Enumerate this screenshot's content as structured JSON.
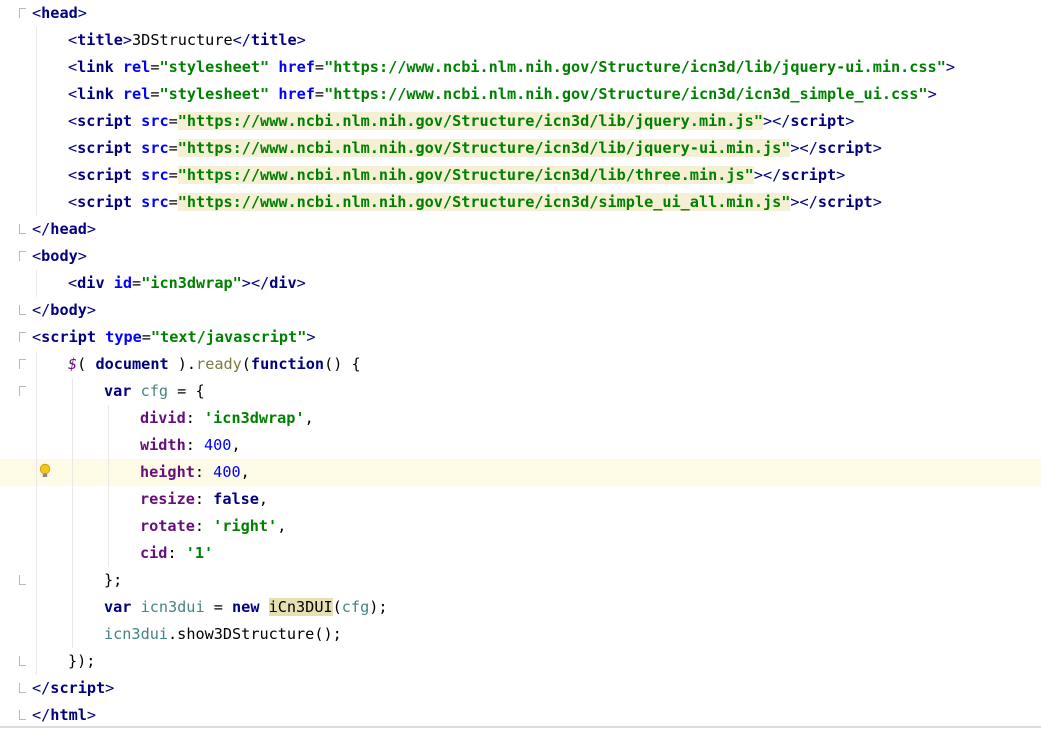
{
  "editor": {
    "lines": [
      {
        "indent": 0,
        "fold": "start",
        "parts": [
          [
            "bracket",
            "<"
          ],
          [
            "tag",
            "head"
          ],
          [
            "bracket",
            ">"
          ]
        ]
      },
      {
        "indent": 1,
        "parts": [
          [
            "bracket",
            "<"
          ],
          [
            "tag",
            "title"
          ],
          [
            "bracket",
            ">"
          ],
          [
            "plain",
            "3DStructure"
          ],
          [
            "bracket",
            "</"
          ],
          [
            "tag",
            "title"
          ],
          [
            "bracket",
            ">"
          ]
        ]
      },
      {
        "indent": 1,
        "parts": [
          [
            "bracket",
            "<"
          ],
          [
            "tag",
            "link "
          ],
          [
            "attr",
            "rel"
          ],
          [
            "plain",
            "="
          ],
          [
            "val",
            "\"stylesheet\" "
          ],
          [
            "attr",
            "href"
          ],
          [
            "plain",
            "="
          ],
          [
            "val",
            "\"https://www.ncbi.nlm.nih.gov/Structure/icn3d/lib/jquery-ui.min.css\""
          ],
          [
            "bracket",
            ">"
          ]
        ]
      },
      {
        "indent": 1,
        "parts": [
          [
            "bracket",
            "<"
          ],
          [
            "tag",
            "link "
          ],
          [
            "attr",
            "rel"
          ],
          [
            "plain",
            "="
          ],
          [
            "val",
            "\"stylesheet\" "
          ],
          [
            "attr",
            "href"
          ],
          [
            "plain",
            "="
          ],
          [
            "val",
            "\"https://www.ncbi.nlm.nih.gov/Structure/icn3d/icn3d_simple_ui.css\""
          ],
          [
            "bracket",
            ">"
          ]
        ]
      },
      {
        "indent": 1,
        "parts": [
          [
            "bracket",
            "<"
          ],
          [
            "tag",
            "script "
          ],
          [
            "attr",
            "src"
          ],
          [
            "plain",
            "="
          ],
          [
            "valhl",
            "\"https://www.ncbi.nlm.nih.gov/Structure/icn3d/lib/jquery.min.js\""
          ],
          [
            "bracket",
            ">"
          ],
          [
            "bracket",
            "</"
          ],
          [
            "tag",
            "script"
          ],
          [
            "bracket",
            ">"
          ]
        ]
      },
      {
        "indent": 1,
        "parts": [
          [
            "bracket",
            "<"
          ],
          [
            "tag",
            "script "
          ],
          [
            "attr",
            "src"
          ],
          [
            "plain",
            "="
          ],
          [
            "valhl",
            "\"https://www.ncbi.nlm.nih.gov/Structure/icn3d/lib/jquery-ui.min.js\""
          ],
          [
            "bracket",
            ">"
          ],
          [
            "bracket",
            "</"
          ],
          [
            "tag",
            "script"
          ],
          [
            "bracket",
            ">"
          ]
        ]
      },
      {
        "indent": 1,
        "parts": [
          [
            "bracket",
            "<"
          ],
          [
            "tag",
            "script "
          ],
          [
            "attr",
            "src"
          ],
          [
            "plain",
            "="
          ],
          [
            "valhl",
            "\"https://www.ncbi.nlm.nih.gov/Structure/icn3d/lib/three.min.js\""
          ],
          [
            "bracket",
            ">"
          ],
          [
            "bracket",
            "</"
          ],
          [
            "tag",
            "script"
          ],
          [
            "bracket",
            ">"
          ]
        ]
      },
      {
        "indent": 1,
        "parts": [
          [
            "bracket",
            "<"
          ],
          [
            "tag",
            "script "
          ],
          [
            "attr",
            "src"
          ],
          [
            "plain",
            "="
          ],
          [
            "valhl",
            "\"https://www.ncbi.nlm.nih.gov/Structure/icn3d/simple_ui_all.min.js\""
          ],
          [
            "bracket",
            ">"
          ],
          [
            "bracket",
            "</"
          ],
          [
            "tag",
            "script"
          ],
          [
            "bracket",
            ">"
          ]
        ]
      },
      {
        "indent": 0,
        "fold": "end",
        "parts": [
          [
            "bracket",
            "</"
          ],
          [
            "tag",
            "head"
          ],
          [
            "bracket",
            ">"
          ]
        ]
      },
      {
        "indent": 0,
        "fold": "start",
        "parts": [
          [
            "bracket",
            "<"
          ],
          [
            "tag",
            "body"
          ],
          [
            "bracket",
            ">"
          ]
        ]
      },
      {
        "indent": 1,
        "parts": [
          [
            "bracket",
            "<"
          ],
          [
            "tag",
            "div "
          ],
          [
            "attr",
            "id"
          ],
          [
            "plain",
            "="
          ],
          [
            "val",
            "\"icn3dwrap\""
          ],
          [
            "bracket",
            ">"
          ],
          [
            "bracket",
            "</"
          ],
          [
            "tag",
            "div"
          ],
          [
            "bracket",
            ">"
          ]
        ]
      },
      {
        "indent": 0,
        "fold": "end",
        "parts": [
          [
            "bracket",
            "</"
          ],
          [
            "tag",
            "body"
          ],
          [
            "bracket",
            ">"
          ]
        ]
      },
      {
        "indent": 0,
        "fold": "start",
        "parts": [
          [
            "bracket",
            "<"
          ],
          [
            "tag",
            "script "
          ],
          [
            "attr",
            "type"
          ],
          [
            "plain",
            "="
          ],
          [
            "val",
            "\"text/javascript\""
          ],
          [
            "bracket",
            ">"
          ]
        ]
      },
      {
        "indent": 1,
        "fold": "start",
        "parts": [
          [
            "dollar",
            "$"
          ],
          [
            "plain",
            "( "
          ],
          [
            "kw",
            "document "
          ],
          [
            "plain",
            ")."
          ],
          [
            "method",
            "ready"
          ],
          [
            "plain",
            "("
          ],
          [
            "kw",
            "function"
          ],
          [
            "plain",
            "() {"
          ]
        ]
      },
      {
        "indent": 2,
        "fold": "start",
        "parts": [
          [
            "kw",
            "var "
          ],
          [
            "ident",
            "cfg "
          ],
          [
            "plain",
            "= {"
          ]
        ]
      },
      {
        "indent": 3,
        "parts": [
          [
            "prop",
            "divid"
          ],
          [
            "plain",
            ": "
          ],
          [
            "val",
            "'icn3dwrap'"
          ],
          [
            "plain",
            ","
          ]
        ]
      },
      {
        "indent": 3,
        "parts": [
          [
            "prop",
            "width"
          ],
          [
            "plain",
            ": "
          ],
          [
            "num",
            "400"
          ],
          [
            "plain",
            ","
          ]
        ]
      },
      {
        "indent": 3,
        "current": true,
        "bulb": true,
        "parts": [
          [
            "prop",
            "height"
          ],
          [
            "plain",
            ": "
          ],
          [
            "num",
            "400"
          ],
          [
            "plain",
            ","
          ]
        ]
      },
      {
        "indent": 3,
        "parts": [
          [
            "prop",
            "resize"
          ],
          [
            "plain",
            ": "
          ],
          [
            "kw",
            "false"
          ],
          [
            "plain",
            ","
          ]
        ]
      },
      {
        "indent": 3,
        "parts": [
          [
            "prop",
            "rotate"
          ],
          [
            "plain",
            ": "
          ],
          [
            "val",
            "'right'"
          ],
          [
            "plain",
            ","
          ]
        ]
      },
      {
        "indent": 3,
        "parts": [
          [
            "prop",
            "cid"
          ],
          [
            "plain",
            ": "
          ],
          [
            "val",
            "'1'"
          ]
        ]
      },
      {
        "indent": 2,
        "fold": "end",
        "parts": [
          [
            "plain",
            "};"
          ]
        ]
      },
      {
        "indent": 2,
        "parts": [
          [
            "kw",
            "var "
          ],
          [
            "ident",
            "icn3dui "
          ],
          [
            "plain",
            "= "
          ],
          [
            "kw",
            "new "
          ],
          [
            "cls",
            "iCn3DUI"
          ],
          [
            "plain",
            "("
          ],
          [
            "ident",
            "cfg"
          ],
          [
            "plain",
            ");"
          ]
        ]
      },
      {
        "indent": 2,
        "parts": [
          [
            "ident",
            "icn3dui"
          ],
          [
            "plain",
            "."
          ],
          [
            "call",
            "show3DStructure"
          ],
          [
            "plain",
            "();"
          ]
        ]
      },
      {
        "indent": 1,
        "fold": "end",
        "parts": [
          [
            "plain",
            "});"
          ]
        ]
      },
      {
        "indent": 0,
        "fold": "end",
        "parts": [
          [
            "bracket",
            "</"
          ],
          [
            "tag",
            "script"
          ],
          [
            "bracket",
            ">"
          ]
        ]
      },
      {
        "indent": 0,
        "fold": "end",
        "parts": [
          [
            "bracket",
            "</"
          ],
          [
            "tag",
            "html"
          ],
          [
            "bracket",
            ">"
          ]
        ]
      }
    ]
  },
  "icons": {
    "fold_marker": "fold-marker-icon",
    "intention": "lightbulb-icon"
  },
  "colors": {
    "current_line": "#fdfbe6",
    "tag": "#000080",
    "attribute": "#0000ff",
    "string": "#008000",
    "property": "#660e7a"
  }
}
